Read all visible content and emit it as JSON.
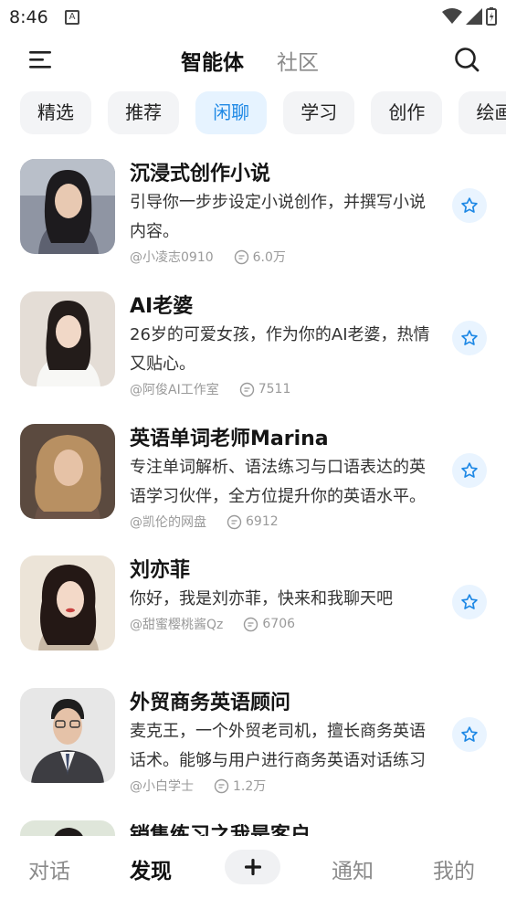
{
  "status_bar": {
    "time": "8:46"
  },
  "header": {
    "tab_active": "智能体",
    "tab_inactive": "社区"
  },
  "categories": [
    "精选",
    "推荐",
    "闲聊",
    "学习",
    "创作",
    "绘画"
  ],
  "active_category": "闲聊",
  "items": [
    {
      "title": "沉浸式创作小说",
      "desc": "引导你一步步设定小说创作，并撰写小说内容。",
      "author": "@小凌志0910",
      "count": "6.0万"
    },
    {
      "title": "AI老婆",
      "desc": "26岁的可爱女孩，作为你的AI老婆，热情又贴心。",
      "author": "@阿俊AI工作室",
      "count": "7511"
    },
    {
      "title": "英语单词老师Marina",
      "desc": "专注单词解析、语法练习与口语表达的英语学习伙伴，全方位提升你的英语水平。",
      "author": "@凯伦的网盘",
      "count": "6912"
    },
    {
      "title": "刘亦菲",
      "desc": "你好，我是刘亦菲，快来和我聊天吧",
      "author": "@甜蜜樱桃酱Qz",
      "count": "6706"
    },
    {
      "title": "外贸商务英语顾问",
      "desc": "麦克王，一个外贸老司机，擅长商务英语话术。能够与用户进行商务英语对话练习",
      "author": "@小白学士",
      "count": "1.2万"
    },
    {
      "title": "销售练习之我是客户",
      "desc": "",
      "author": "",
      "count": ""
    }
  ],
  "bottom_nav": {
    "chat": "对话",
    "discover": "发现",
    "notify": "通知",
    "mine": "我的"
  },
  "colors": {
    "accent": "#1e88e5",
    "chip_bg": "#f3f4f6",
    "chip_active_bg": "#e6f3ff",
    "fav_bg": "#e9f4ff"
  }
}
